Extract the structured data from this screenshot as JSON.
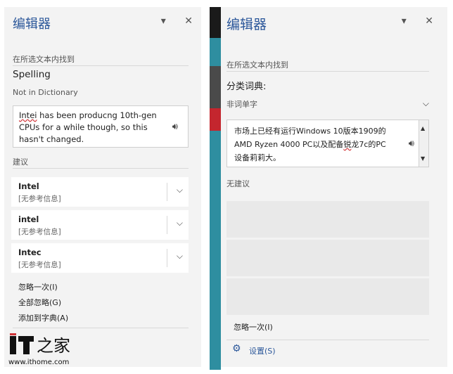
{
  "left": {
    "title": "编辑器",
    "found_label": "在所选文本内找到",
    "category": "Spelling",
    "category_note": "Not in Dictionary",
    "text_word": "Intei",
    "text_rest": " has been producng 10th-gen CPUs for a while though, so this hasn't changed.",
    "suggestions_label": "建议",
    "suggestions": [
      {
        "word": "Intel",
        "note": "[无参考信息]"
      },
      {
        "word": "intel",
        "note": "[无参考信息]"
      },
      {
        "word": "Intec",
        "note": "[无参考信息]"
      }
    ],
    "actions": {
      "ignore_once": "忽略一次(I)",
      "ignore_all": "全部忽略(G)",
      "add_dict": "添加到字典(A)"
    }
  },
  "right": {
    "title": "编辑器",
    "found_label": "在所选文本内找到",
    "category": "分类词典:",
    "category_note": "非词单字",
    "text_before": "市场上已经有运行Windows 10版本1909的AMD Ryzen 4000 PC以及配备",
    "text_word": "锐",
    "text_after": "龙7c的PC设备莉莉大。",
    "no_suggestions": "无建议",
    "ignore_once": "忽略一次(I)",
    "settings": "设置(S)"
  },
  "watermark": {
    "url": "www.ithome.com"
  },
  "colors": {
    "accent": "#2b579a",
    "pane_bg": "#f3f3f3",
    "squiggle": "#d13438"
  }
}
